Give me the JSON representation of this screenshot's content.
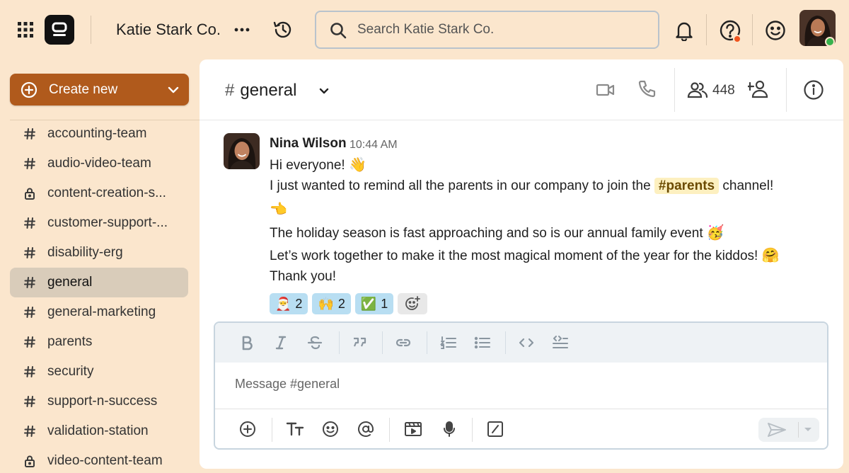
{
  "app": {
    "team_name": "Katie Stark Co.",
    "search_placeholder": "Search Katie Stark Co."
  },
  "topbar": {
    "icons": [
      "apps-grid-icon",
      "app-logo",
      "more-horizontal-icon",
      "history-icon",
      "search-icon",
      "bell-icon",
      "help-icon",
      "smiley-icon",
      "user-avatar"
    ],
    "help_badge_color": "#f0541e",
    "status": "online"
  },
  "sidebar": {
    "create_label": "Create new",
    "create_color": "#b05a1c",
    "channels": [
      {
        "name": "accounting-team",
        "type": "public"
      },
      {
        "name": "audio-video-team",
        "type": "public"
      },
      {
        "name": "content-creation-s...",
        "type": "private"
      },
      {
        "name": "customer-support-...",
        "type": "public"
      },
      {
        "name": "disability-erg",
        "type": "public"
      },
      {
        "name": "general",
        "type": "public",
        "active": true
      },
      {
        "name": "general-marketing",
        "type": "public"
      },
      {
        "name": "parents",
        "type": "public"
      },
      {
        "name": "security",
        "type": "public"
      },
      {
        "name": "support-n-success",
        "type": "public"
      },
      {
        "name": "validation-station",
        "type": "public"
      },
      {
        "name": "video-content-team",
        "type": "private"
      }
    ]
  },
  "channel": {
    "hash": "#",
    "name": "general",
    "member_count": "448"
  },
  "message": {
    "author": "Nina Wilson",
    "time": "10:44 AM",
    "line1_text": "Hi everyone! ",
    "line1_emoji": "👋",
    "line2_pre": "I just wanted to remind all the parents in our company to join the ",
    "line2_mention": "#parents",
    "line2_post": " channel!",
    "line3_emoji": "👈",
    "line4_text": "The holiday season is fast approaching and so is our annual family event ",
    "line4_emoji": "🥳",
    "line5_text": "Let’s work together to make it the most magical moment of the year for the kiddos! ",
    "line5_emoji": "🤗",
    "line6_text": "Thank you!",
    "reactions": [
      {
        "emoji": "🎅",
        "count": "2"
      },
      {
        "emoji": "🙌",
        "count": "2"
      },
      {
        "emoji": "✅",
        "count": "1"
      }
    ]
  },
  "composer": {
    "placeholder": "Message #general"
  }
}
